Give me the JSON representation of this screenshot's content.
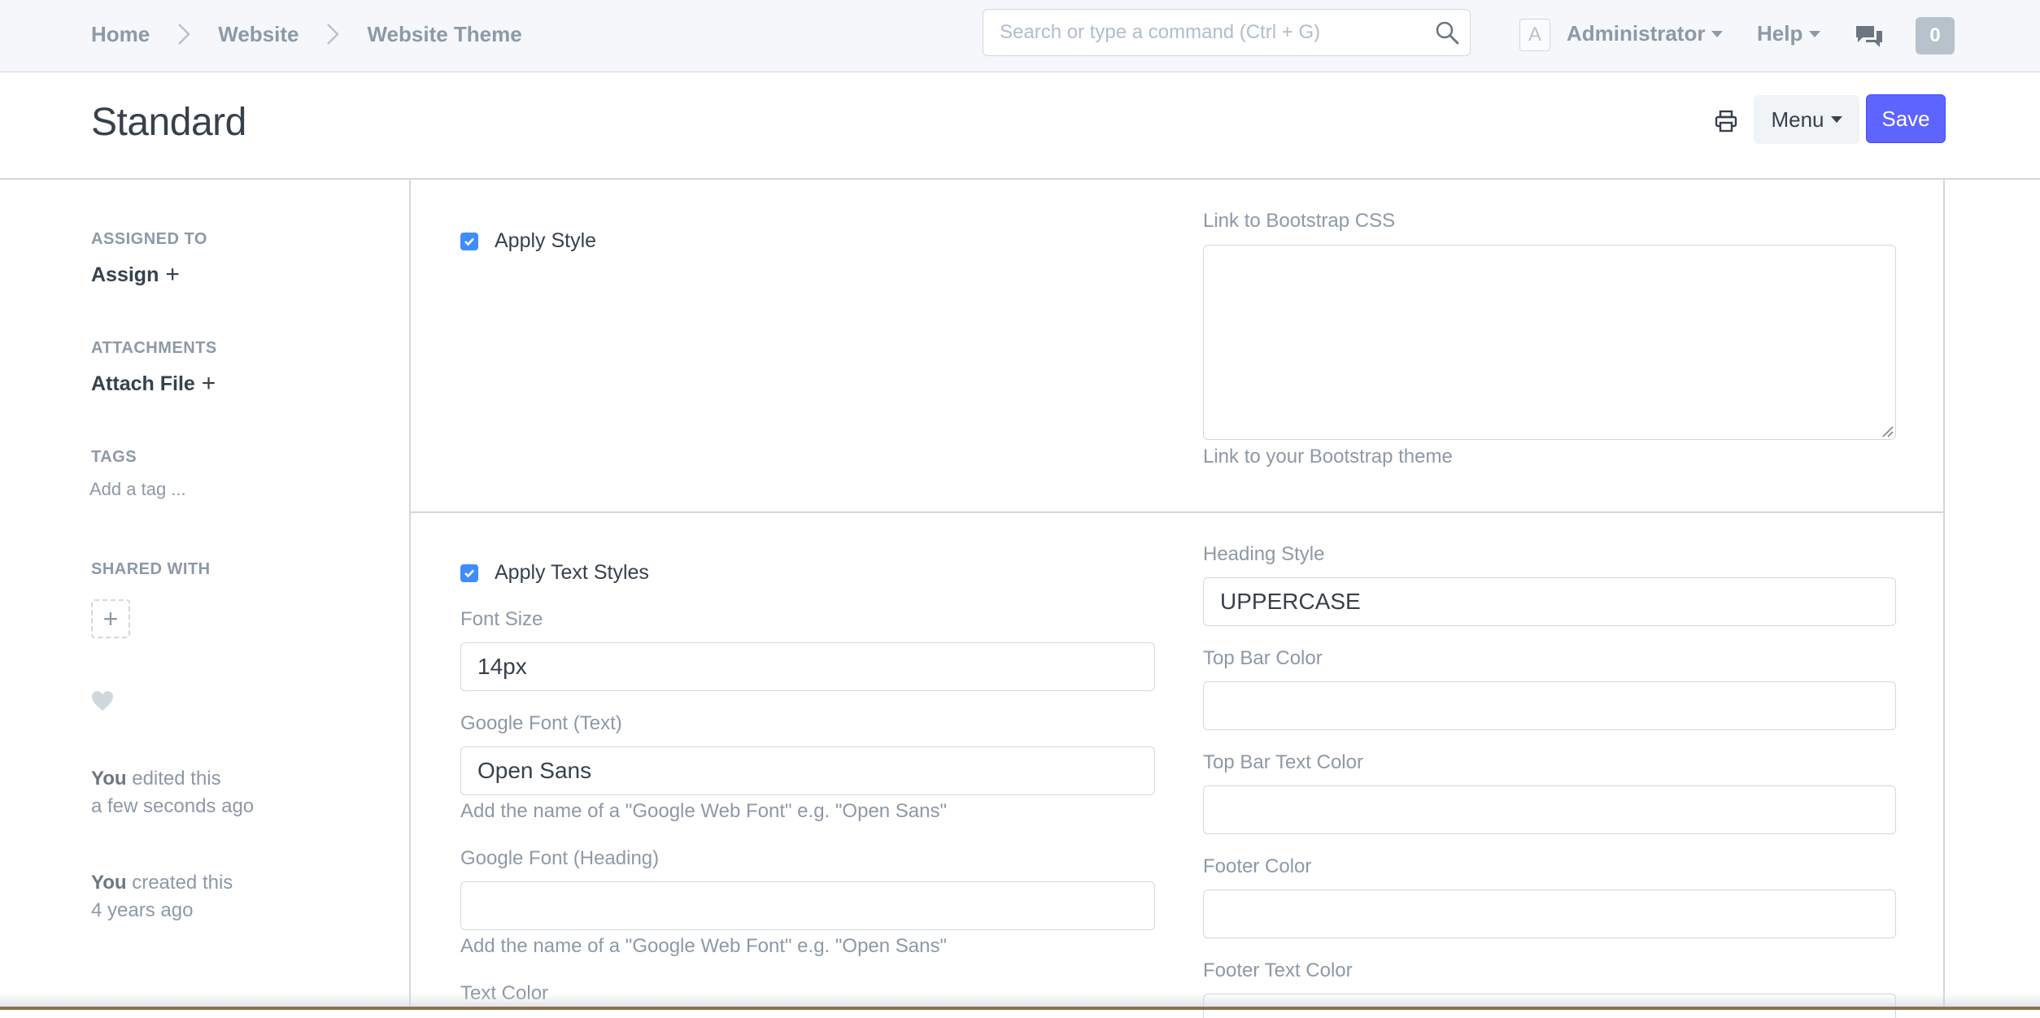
{
  "breadcrumb": [
    "Home",
    "Website",
    "Website Theme"
  ],
  "search": {
    "placeholder": "Search or type a command (Ctrl + G)"
  },
  "user": {
    "avatar_letter": "A",
    "name": "Administrator"
  },
  "nav": {
    "help_label": "Help",
    "notifications_count": "0"
  },
  "page": {
    "title": "Standard",
    "menu_label": "Menu",
    "save_label": "Save"
  },
  "sidebar": {
    "assigned_to_label": "ASSIGNED TO",
    "assign_action": "Assign",
    "attachments_label": "ATTACHMENTS",
    "attach_action": "Attach File",
    "tags_label": "TAGS",
    "add_tag_placeholder": "Add a tag ...",
    "shared_with_label": "SHARED WITH",
    "timeline": [
      {
        "actor": "You",
        "action": "edited this",
        "time": "a few seconds ago"
      },
      {
        "actor": "You",
        "action": "created this",
        "time": "4 years ago"
      }
    ]
  },
  "form": {
    "apply_style": {
      "label": "Apply Style",
      "checked": true
    },
    "bootstrap_css": {
      "label": "Link to Bootstrap CSS",
      "value": "",
      "help": "Link to your Bootstrap theme"
    },
    "apply_text_styles": {
      "label": "Apply Text Styles",
      "checked": true
    },
    "font_size": {
      "label": "Font Size",
      "value": "14px"
    },
    "google_font_text": {
      "label": "Google Font (Text)",
      "value": "Open Sans",
      "help": "Add the name of a \"Google Web Font\" e.g. \"Open Sans\""
    },
    "google_font_heading": {
      "label": "Google Font (Heading)",
      "value": "",
      "help": "Add the name of a \"Google Web Font\" e.g. \"Open Sans\""
    },
    "text_color": {
      "label": "Text Color"
    },
    "heading_style": {
      "label": "Heading Style",
      "value": "UPPERCASE"
    },
    "top_bar_color": {
      "label": "Top Bar Color",
      "value": ""
    },
    "top_bar_text_color": {
      "label": "Top Bar Text Color",
      "value": ""
    },
    "footer_color": {
      "label": "Footer Color",
      "value": ""
    },
    "footer_text_color": {
      "label": "Footer Text Color"
    }
  },
  "colors": {
    "primary": "#5e64ff",
    "checkbox": "#3f8cff",
    "muted_text": "#8d99a6",
    "border": "#d1d8dd"
  }
}
